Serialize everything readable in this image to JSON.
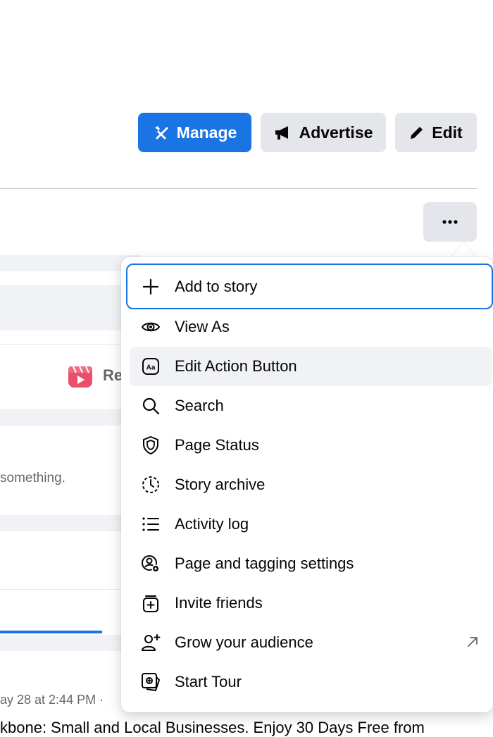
{
  "header": {
    "manage_label": "Manage",
    "advertise_label": "Advertise",
    "edit_label": "Edit"
  },
  "background": {
    "reels_label": "Re",
    "composer_hint": "something.",
    "post_date": "ay 28 at 2:44 PM ·",
    "post_text": "kbone: Small and Local Businesses. Enjoy 30 Days Free from"
  },
  "menu": {
    "items": [
      {
        "label": "Add to story",
        "icon": "plus-icon"
      },
      {
        "label": "View As",
        "icon": "eye-icon"
      },
      {
        "label": "Edit Action Button",
        "icon": "action-button-icon"
      },
      {
        "label": "Search",
        "icon": "search-icon"
      },
      {
        "label": "Page Status",
        "icon": "shield-icon"
      },
      {
        "label": "Story archive",
        "icon": "clock-icon"
      },
      {
        "label": "Activity log",
        "icon": "list-icon"
      },
      {
        "label": "Page and tagging settings",
        "icon": "settings-icon"
      },
      {
        "label": "Invite friends",
        "icon": "invite-icon"
      },
      {
        "label": "Grow your audience",
        "icon": "add-person-icon"
      },
      {
        "label": "Start Tour",
        "icon": "tour-icon"
      }
    ]
  },
  "colors": {
    "accent": "#1b74e4",
    "button_grey": "#e4e6eb",
    "page_grey": "#f0f2f5"
  }
}
